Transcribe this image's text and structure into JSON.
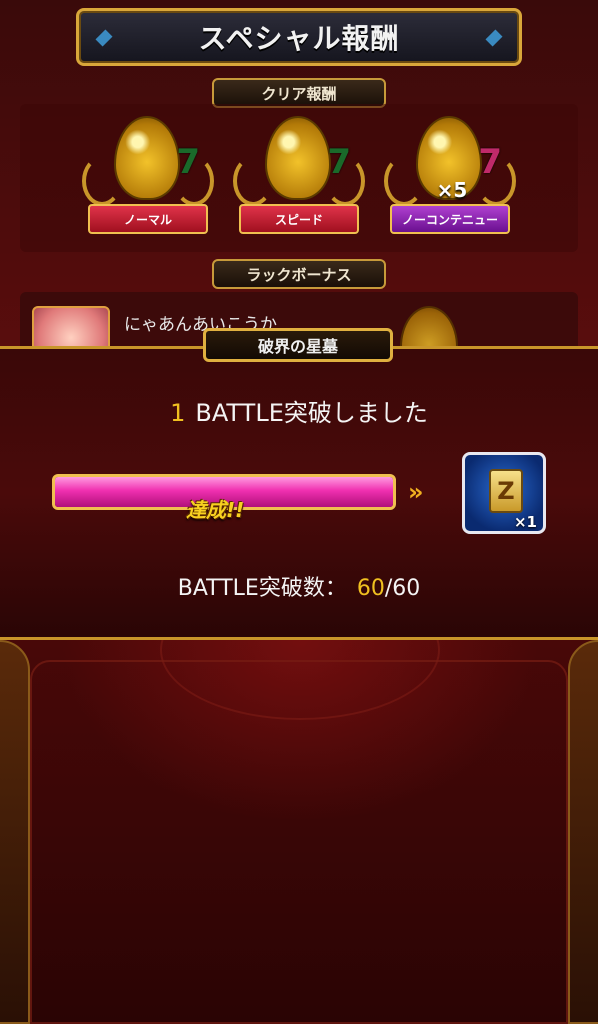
{
  "header": {
    "title": "スペシャル報酬"
  },
  "clear_rewards": {
    "label": "クリア報酬",
    "items": [
      {
        "ribbon": "ノーマル",
        "multiplier": ""
      },
      {
        "ribbon": "スピード",
        "multiplier": ""
      },
      {
        "ribbon": "ノーコンテニュー",
        "multiplier": "×5"
      }
    ]
  },
  "luck_bonus": {
    "label": "ラックボーナス",
    "character_name": "にゃあんあいこうか"
  },
  "popup": {
    "quest_name": "破界の星墓",
    "battle_count": "1",
    "battle_message": "BATTLE突破しました",
    "progress_label": "達成!!",
    "progress_fraction": 1.0,
    "arrows": "»",
    "reward_icon": "scroll-icon",
    "reward_glyph": "Z",
    "reward_qty": "×1",
    "count_label": "BATTLE突破数：",
    "count_current": "60",
    "count_total": "/60"
  },
  "colors": {
    "accent_gold": "#f0c020",
    "progress_pink": "#f030b0"
  }
}
